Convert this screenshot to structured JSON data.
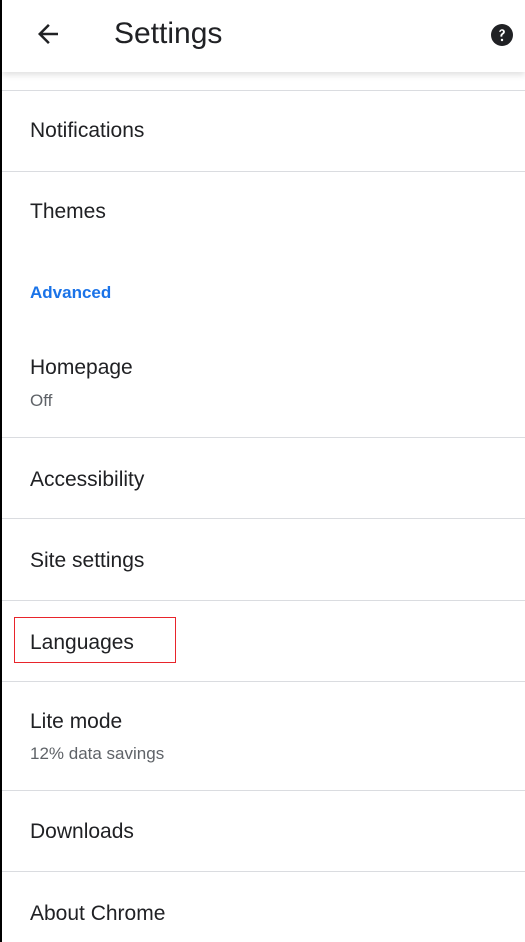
{
  "header": {
    "title": "Settings",
    "back_icon": "arrow-left-icon",
    "help_icon": "help-circle-icon"
  },
  "items": [
    {
      "label": "Notifications"
    },
    {
      "label": "Themes"
    },
    {
      "label": "Homepage",
      "sublabel": "Off"
    },
    {
      "label": "Accessibility"
    },
    {
      "label": "Site settings"
    },
    {
      "label": "Languages"
    },
    {
      "label": "Lite mode",
      "sublabel": "12% data savings"
    },
    {
      "label": "Downloads"
    },
    {
      "label": "About Chrome"
    }
  ],
  "sections": {
    "advanced": "Advanced"
  },
  "colors": {
    "accent": "#1a73e8",
    "highlight": "#e8242b",
    "divider": "#dadce0"
  }
}
